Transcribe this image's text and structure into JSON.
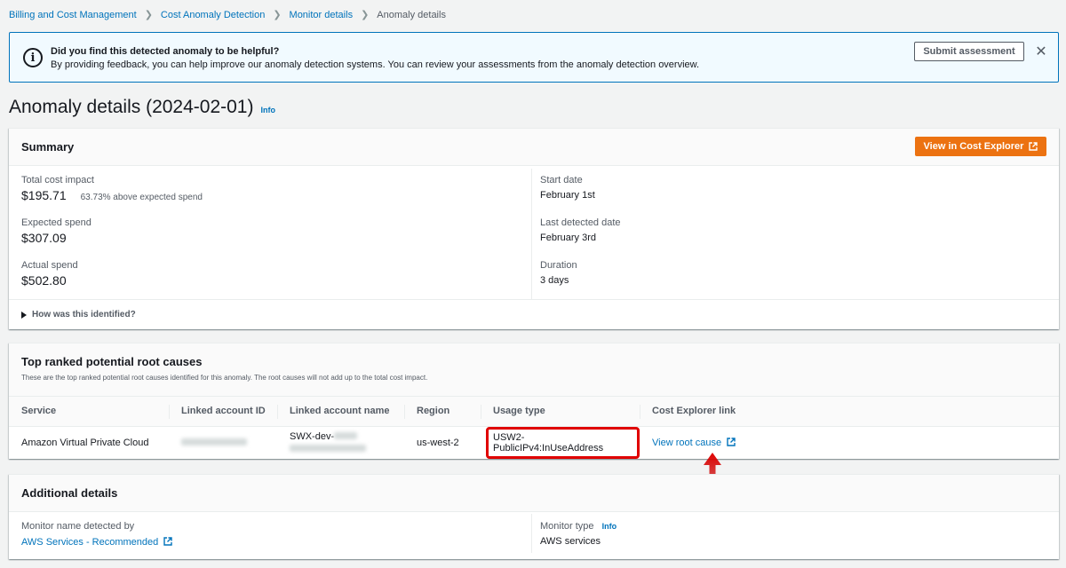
{
  "breadcrumb": [
    "Billing and Cost Management",
    "Cost Anomaly Detection",
    "Monitor details",
    "Anomaly details"
  ],
  "flash": {
    "title": "Did you find this detected anomaly to be helpful?",
    "text": "By providing feedback, you can help improve our anomaly detection systems. You can review your assessments from the anomaly detection overview.",
    "button": "Submit assessment"
  },
  "page": {
    "title": "Anomaly details (2024-02-01)",
    "info": "Info"
  },
  "summary": {
    "title": "Summary",
    "button": "View in Cost Explorer",
    "total_cost_impact_label": "Total cost impact",
    "total_cost_impact": "$195.71",
    "above_expected": "63.73% above expected spend",
    "expected_spend_label": "Expected spend",
    "expected_spend": "$307.09",
    "actual_spend_label": "Actual spend",
    "actual_spend": "$502.80",
    "start_date_label": "Start date",
    "start_date": "February 1st",
    "last_detected_label": "Last detected date",
    "last_detected": "February 3rd",
    "duration_label": "Duration",
    "duration": "3 days",
    "expander": "How was this identified?"
  },
  "root_causes": {
    "title": "Top ranked potential root causes",
    "description": "These are the top ranked potential root causes identified for this anomaly. The root causes will not add up to the total cost impact.",
    "columns": [
      "Service",
      "Linked account ID",
      "Linked account name",
      "Region",
      "Usage type",
      "Cost Explorer link"
    ],
    "rows": [
      {
        "service": "Amazon Virtual Private Cloud",
        "account_name_prefix": "SWX-dev-",
        "region": "us-west-2",
        "usage_type": "USW2-PublicIPv4:InUseAddress",
        "link": "View root cause"
      }
    ]
  },
  "additional": {
    "title": "Additional details",
    "monitor_name_label": "Monitor name detected by",
    "monitor_name": "AWS Services - Recommended",
    "monitor_type_label": "Monitor type",
    "monitor_type_info": "Info",
    "monitor_type": "AWS services"
  },
  "colors": {
    "primary": "#ec7211",
    "link": "#0073bb",
    "highlight": "#e00000"
  },
  "icons": [
    "info-circle-icon",
    "close-icon",
    "external-link-icon",
    "caret-right-icon",
    "chevron-right-icon",
    "arrow-up-icon"
  ]
}
